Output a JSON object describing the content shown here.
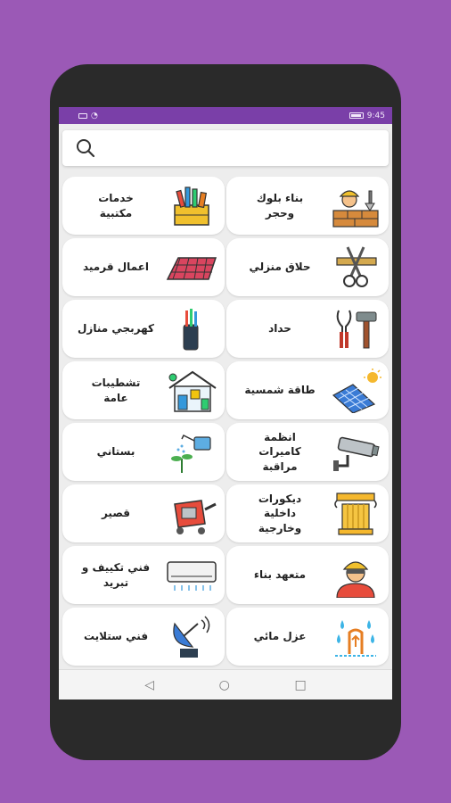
{
  "status": {
    "time": "9:45"
  },
  "search": {
    "placeholder": ""
  },
  "services": [
    {
      "label": "خدمات\nمكتبية",
      "icon": "stationery-icon"
    },
    {
      "label": "بناء بلوك\nوحجر",
      "icon": "bricklayer-icon"
    },
    {
      "label": "اعمال قرميد",
      "icon": "roof-tiles-icon"
    },
    {
      "label": "حلاق منزلي",
      "icon": "barber-scissors-icon"
    },
    {
      "label": "كهربجي منازل",
      "icon": "electric-cable-icon"
    },
    {
      "label": "حداد",
      "icon": "pliers-hammer-icon"
    },
    {
      "label": "تشطيبات\nعامة",
      "icon": "house-finishing-icon"
    },
    {
      "label": "طاقة شمسية",
      "icon": "solar-panel-icon"
    },
    {
      "label": "بستاني",
      "icon": "watering-can-icon"
    },
    {
      "label": "انظمة\nكاميرات\nمراقبة",
      "icon": "cctv-camera-icon"
    },
    {
      "label": "قصير",
      "icon": "cement-mixer-icon"
    },
    {
      "label": "ديكورات\nداخلية\nوخارجية",
      "icon": "column-pillar-icon"
    },
    {
      "label": "فني تكييف و\nتبريد",
      "icon": "air-conditioner-icon"
    },
    {
      "label": "متعهد بناء",
      "icon": "construction-worker-icon"
    },
    {
      "label": "فني ستلايت",
      "icon": "satellite-dish-icon"
    },
    {
      "label": "عزل مائي",
      "icon": "waterproofing-icon"
    }
  ],
  "colors": {
    "statusbar": "#7a3fa8",
    "background": "#9b59b6"
  }
}
